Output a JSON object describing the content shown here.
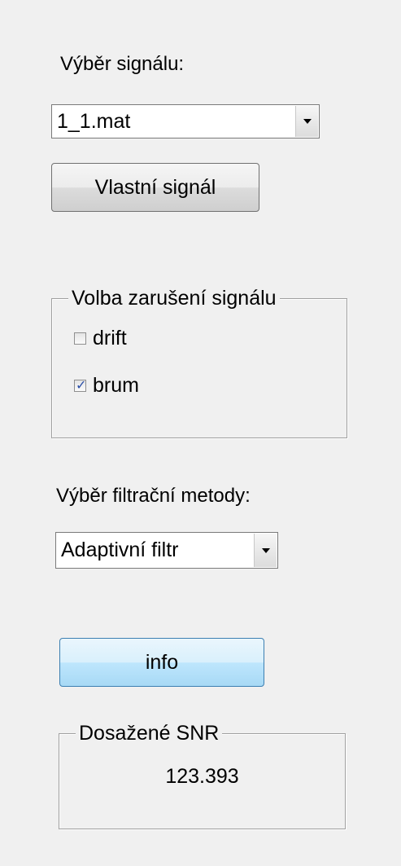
{
  "signal_selection": {
    "label": "Výběr signálu:",
    "selected": "1_1.mat"
  },
  "custom_signal_button": "Vlastní signál",
  "noise_group": {
    "title": "Volba zarušení signálu",
    "options": [
      {
        "label": "drift",
        "checked": false
      },
      {
        "label": "brum",
        "checked": true
      }
    ],
    "check_glyph": "✓"
  },
  "filter_selection": {
    "label": "Výběr filtrační metody:",
    "selected": "Adaptivní filtr"
  },
  "info_button": "info",
  "snr_group": {
    "title": "Dosažené SNR",
    "value": "123.393"
  }
}
